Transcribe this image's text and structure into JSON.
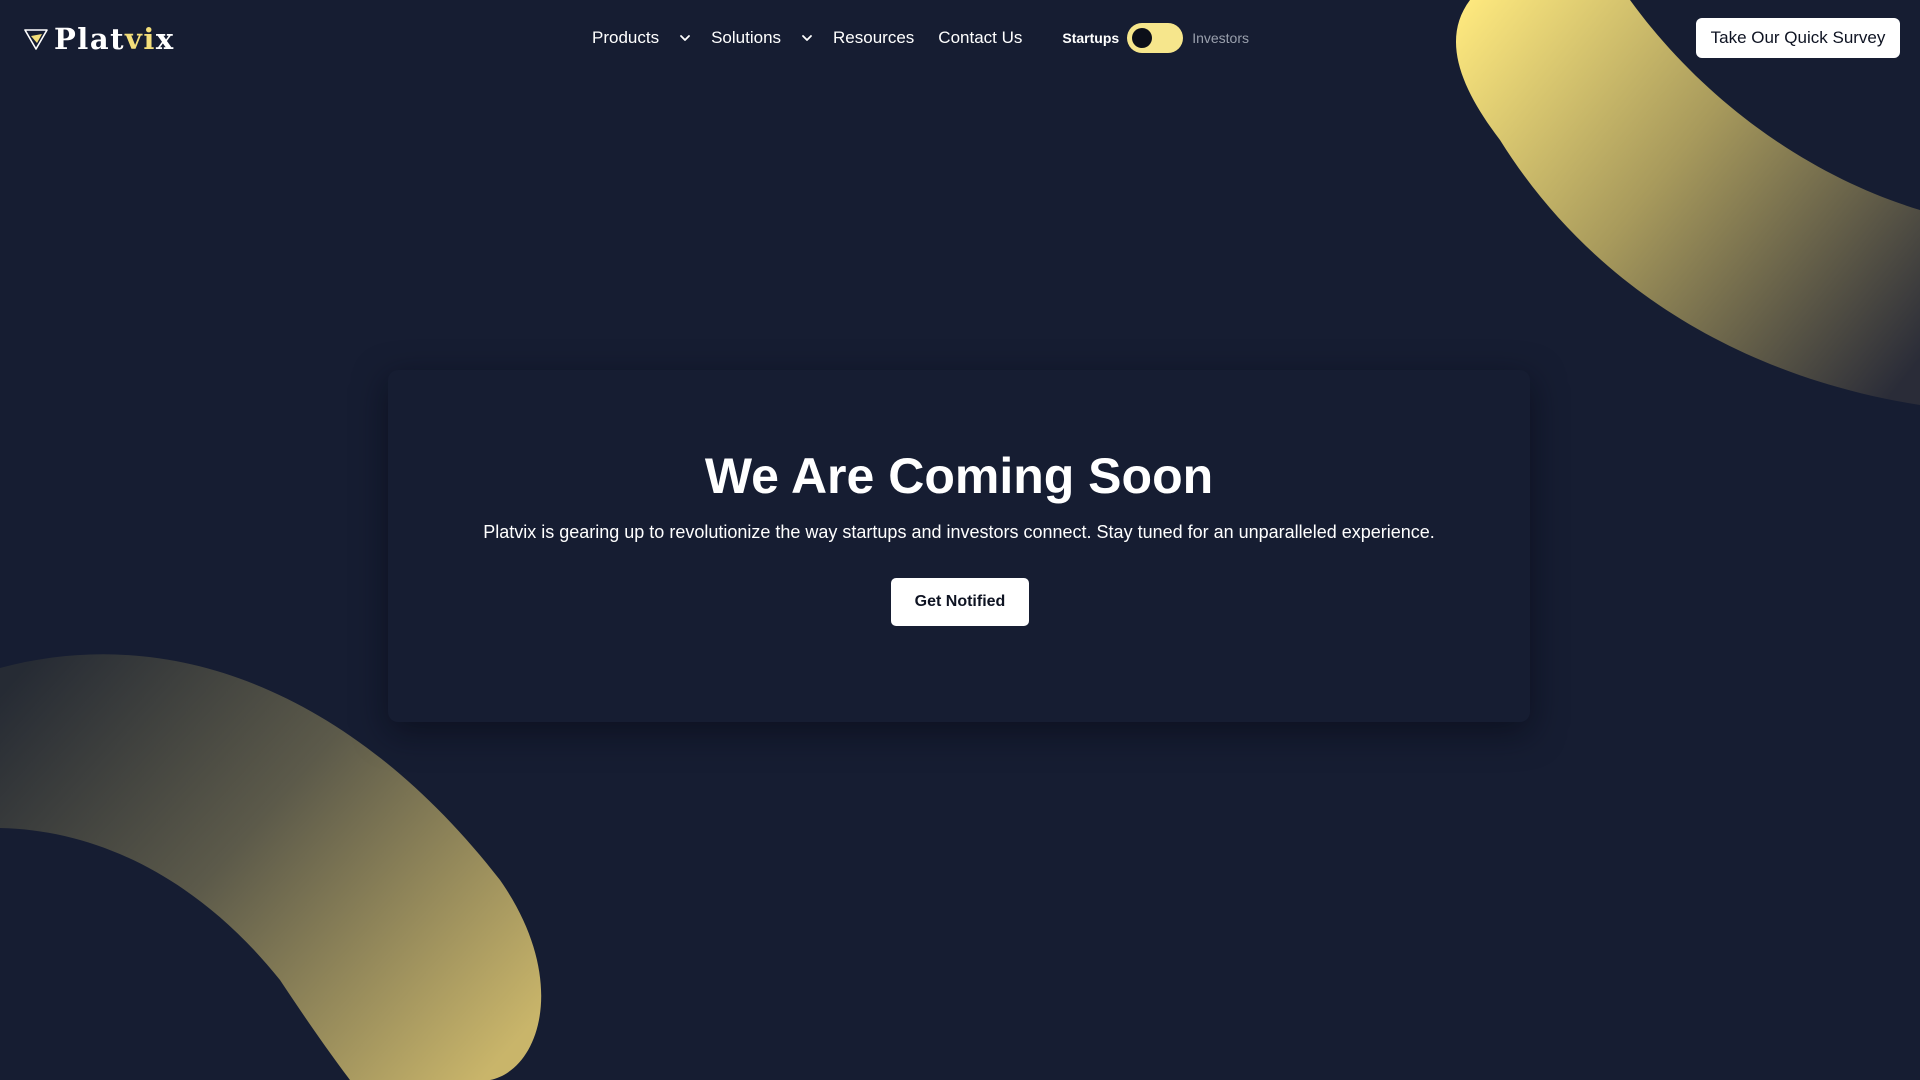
{
  "brand": {
    "name_main": "Plat",
    "name_accent": "vi",
    "name_end": "x",
    "accent_color": "#f3de7a"
  },
  "nav": {
    "products": "Products",
    "solutions": "Solutions",
    "resources": "Resources",
    "contact": "Contact Us",
    "toggle": {
      "left_label": "Startups",
      "right_label": "Investors",
      "selected": "Startups",
      "track_color": "#f6e68c"
    },
    "survey_button": "Take Our Quick Survey"
  },
  "hero": {
    "title": "We Are Coming Soon",
    "subtitle": "Platvix is gearing up to revolutionize the way startups and investors connect. Stay tuned for an unparalleled experience.",
    "cta": "Get Notified"
  },
  "theme": {
    "background": "#161d32",
    "accent": "#f3de7a",
    "button_bg": "#ffffff"
  },
  "icons": {
    "logo": "paper-plane-icon",
    "dropdown": "chevron-down-icon"
  }
}
